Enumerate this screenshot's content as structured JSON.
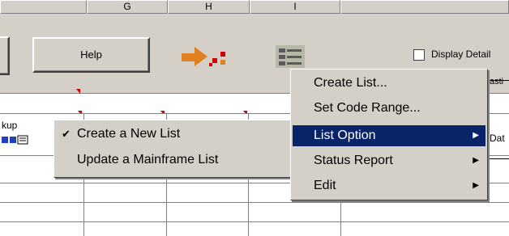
{
  "sheet": {
    "columns": [
      "G",
      "H",
      "I"
    ],
    "partial_cell_texts": [
      "kup",
      "Dat"
    ]
  },
  "toolbar": {
    "help_label": "Help",
    "display_details_label": "Display Detail",
    "display_details_checked": false,
    "truncated_right_text": "asti"
  },
  "main_menu": {
    "items": [
      {
        "label": "Create List...",
        "highlighted": false,
        "submenu": false
      },
      {
        "label": "Set Code Range...",
        "highlighted": false,
        "submenu": false
      },
      {
        "label": "List Option",
        "highlighted": true,
        "submenu": true
      },
      {
        "label": "Status Report",
        "highlighted": false,
        "submenu": true
      },
      {
        "label": "Edit",
        "highlighted": false,
        "submenu": true
      }
    ]
  },
  "submenu": {
    "items": [
      {
        "label": "Create a New List",
        "checked": true
      },
      {
        "label": "Update a Mainframe List",
        "checked": false
      }
    ]
  },
  "colors": {
    "face": "#d4d0c8",
    "highlight": "#0a246a",
    "accent_red": "#d00000",
    "accent_orange": "#e08020"
  }
}
